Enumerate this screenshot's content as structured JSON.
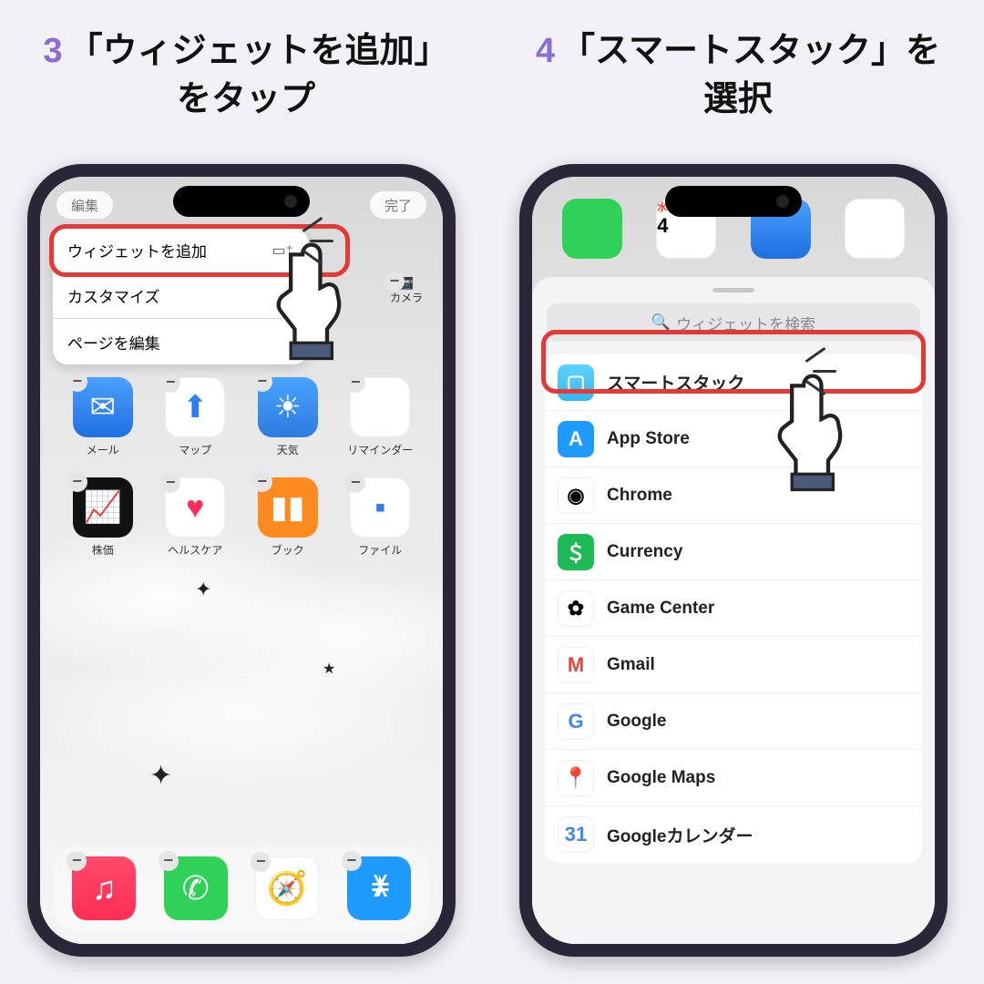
{
  "step3": {
    "num": "3",
    "title_line1": "「ウィジェットを追加」",
    "title_line2": "をタップ"
  },
  "step4": {
    "num": "4",
    "title_line1": "「スマートスタック」を",
    "title_line2": "選択"
  },
  "left": {
    "edit_pill": "編集",
    "done_pill": "完了",
    "menu": {
      "add_widget": "ウィジェットを追加",
      "customize": "カスタマイズ",
      "edit_page": "ページを編集"
    },
    "camera_label": "カメラ",
    "apps": [
      {
        "k": "mail",
        "label": "メール"
      },
      {
        "k": "maps",
        "label": "マップ"
      },
      {
        "k": "weather",
        "label": "天気"
      },
      {
        "k": "rem",
        "label": "リマインダー"
      },
      {
        "k": "stk",
        "label": "株価"
      },
      {
        "k": "health",
        "label": "ヘルスケア"
      },
      {
        "k": "book",
        "label": "ブック"
      },
      {
        "k": "files",
        "label": "ファイル"
      }
    ]
  },
  "right": {
    "search_placeholder": "ウィジェットを検索",
    "cal_day": "水",
    "cal_date": "4",
    "list": [
      {
        "k": "smart",
        "label": "スマートスタック"
      },
      {
        "k": "astore",
        "label": "App Store"
      },
      {
        "k": "chrome",
        "label": "Chrome"
      },
      {
        "k": "curr",
        "label": "Currency"
      },
      {
        "k": "gc",
        "label": "Game Center"
      },
      {
        "k": "gmail",
        "label": "Gmail"
      },
      {
        "k": "google",
        "label": "Google"
      },
      {
        "k": "gmaps",
        "label": "Google Maps"
      },
      {
        "k": "gcal",
        "label": "Googleカレンダー"
      }
    ]
  }
}
